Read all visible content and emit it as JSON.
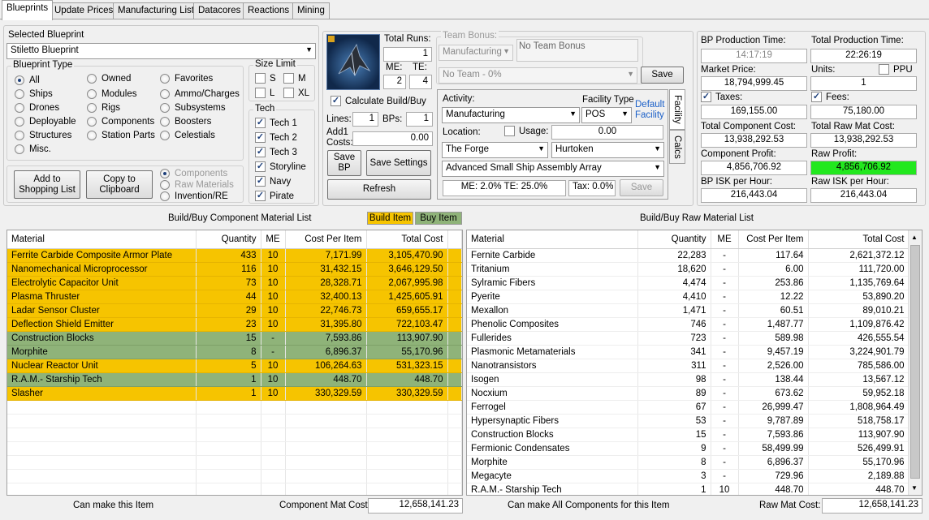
{
  "tabs": [
    "Blueprints",
    "Update Prices",
    "Manufacturing List",
    "Datacores",
    "Reactions",
    "Mining"
  ],
  "selected_blueprint_label": "Selected Blueprint",
  "selected_blueprint": "Stiletto Blueprint",
  "blueprint_type": {
    "title": "Blueprint Type",
    "options": [
      "All",
      "Ships",
      "Drones",
      "Deployable",
      "Structures",
      "Misc.",
      "Owned",
      "Modules",
      "Rigs",
      "Components",
      "Station Parts",
      "Favorites",
      "Ammo/Charges",
      "Subsystems",
      "Boosters",
      "Celestials"
    ]
  },
  "size_limit": {
    "title": "Size Limit",
    "options": [
      "S",
      "M",
      "L",
      "XL"
    ]
  },
  "tech": {
    "title": "Tech",
    "options": [
      "Tech 1",
      "Tech 2",
      "Tech 3",
      "Storyline",
      "Navy",
      "Pirate"
    ]
  },
  "buttons": {
    "add_to_shopping_list": "Add to Shopping List",
    "copy_to_clipboard": "Copy to Clipboard",
    "save_bp": "Save BP",
    "save_settings": "Save Settings",
    "refresh": "Refresh",
    "save": "Save"
  },
  "copy_options": [
    "Components",
    "Raw Materials",
    "Invention/RE"
  ],
  "bp": {
    "total_runs_label": "Total Runs:",
    "total_runs": "1",
    "me_label": "ME:",
    "me": "2",
    "te_label": "TE:",
    "te": "4",
    "calc_build_buy": "Calculate Build/Buy",
    "lines_label": "Lines:",
    "lines": "1",
    "bps_label": "BPs:",
    "bps": "1",
    "add1_costs_label": "Add1 Costs:",
    "add1_costs": "0.00"
  },
  "team": {
    "label": "Team Bonus:",
    "activity": "Manufacturing",
    "bonus_text": "No Team Bonus",
    "team_select": "No Team - 0%"
  },
  "facility": {
    "activity_label": "Activity:",
    "activity": "Manufacturing",
    "facility_type_label": "Facility Type",
    "facility_type": "POS",
    "default_facility": "Default Facility",
    "location_label": "Location:",
    "usage_label": "Usage:",
    "usage": "0.00",
    "region": "The Forge",
    "system": "Hurtoken",
    "array": "Advanced Small Ship Assembly Array",
    "me_te": "ME: 2.0% TE: 25.0%",
    "tax": "Tax: 0.0%",
    "side_tabs": [
      "Facility",
      "Calcs"
    ]
  },
  "stats": {
    "bp_production_time_label": "BP Production Time:",
    "bp_production_time": "14:17:19",
    "total_production_time_label": "Total Production Time:",
    "total_production_time": "22:26:19",
    "market_price_label": "Market Price:",
    "market_price": "18,794,999.45",
    "units_label": "Units:",
    "units": "1",
    "ppu_label": "PPU",
    "taxes_label": "Taxes:",
    "taxes": "169,155.00",
    "fees_label": "Fees:",
    "fees": "75,180.00",
    "total_component_cost_label": "Total Component Cost:",
    "total_component_cost": "13,938,292.53",
    "total_raw_mat_cost_label": "Total Raw Mat Cost:",
    "total_raw_mat_cost": "13,938,292.53",
    "component_profit_label": "Component Profit:",
    "component_profit": "4,856,706.92",
    "raw_profit_label": "Raw Profit:",
    "raw_profit": "4,856,706.92",
    "bp_isk_per_hour_label": "BP ISK per Hour:",
    "bp_isk_per_hour": "216,443.04",
    "raw_isk_per_hour_label": "Raw ISK per Hour:",
    "raw_isk_per_hour": "216,443.04"
  },
  "component_list": {
    "title": "Build/Buy Component Material List",
    "legend_build": "Build Item",
    "legend_buy": "Buy Item",
    "columns": [
      "Material",
      "Quantity",
      "ME",
      "Cost Per Item",
      "Total Cost"
    ],
    "rows": [
      {
        "type": "build",
        "cells": [
          "Ferrite Carbide Composite Armor Plate",
          "433",
          "10",
          "7,171.99",
          "3,105,470.90"
        ]
      },
      {
        "type": "build",
        "cells": [
          "Nanomechanical Microprocessor",
          "116",
          "10",
          "31,432.15",
          "3,646,129.50"
        ]
      },
      {
        "type": "build",
        "cells": [
          "Electrolytic Capacitor Unit",
          "73",
          "10",
          "28,328.71",
          "2,067,995.98"
        ]
      },
      {
        "type": "build",
        "cells": [
          "Plasma Thruster",
          "44",
          "10",
          "32,400.13",
          "1,425,605.91"
        ]
      },
      {
        "type": "build",
        "cells": [
          "Ladar Sensor Cluster",
          "29",
          "10",
          "22,746.73",
          "659,655.17"
        ]
      },
      {
        "type": "build",
        "cells": [
          "Deflection Shield Emitter",
          "23",
          "10",
          "31,395.80",
          "722,103.47"
        ]
      },
      {
        "type": "buy",
        "cells": [
          "Construction Blocks",
          "15",
          "-",
          "7,593.86",
          "113,907.90"
        ]
      },
      {
        "type": "buy",
        "cells": [
          "Morphite",
          "8",
          "-",
          "6,896.37",
          "55,170.96"
        ]
      },
      {
        "type": "build",
        "cells": [
          "Nuclear Reactor Unit",
          "5",
          "10",
          "106,264.63",
          "531,323.15"
        ]
      },
      {
        "type": "buy",
        "cells": [
          "R.A.M.- Starship Tech",
          "1",
          "10",
          "448.70",
          "448.70"
        ]
      },
      {
        "type": "build",
        "cells": [
          "Slasher",
          "1",
          "10",
          "330,329.59",
          "330,329.59"
        ]
      }
    ]
  },
  "raw_list": {
    "title": "Build/Buy Raw Material List",
    "columns": [
      "Material",
      "Quantity",
      "ME",
      "Cost Per Item",
      "Total Cost"
    ],
    "rows": [
      [
        "Fernite Carbide",
        "22,283",
        "-",
        "117.64",
        "2,621,372.12"
      ],
      [
        "Tritanium",
        "18,620",
        "-",
        "6.00",
        "111,720.00"
      ],
      [
        "Sylramic Fibers",
        "4,474",
        "-",
        "253.86",
        "1,135,769.64"
      ],
      [
        "Pyerite",
        "4,410",
        "-",
        "12.22",
        "53,890.20"
      ],
      [
        "Mexallon",
        "1,471",
        "-",
        "60.51",
        "89,010.21"
      ],
      [
        "Phenolic Composites",
        "746",
        "-",
        "1,487.77",
        "1,109,876.42"
      ],
      [
        "Fullerides",
        "723",
        "-",
        "589.98",
        "426,555.54"
      ],
      [
        "Plasmonic Metamaterials",
        "341",
        "-",
        "9,457.19",
        "3,224,901.79"
      ],
      [
        "Nanotransistors",
        "311",
        "-",
        "2,526.00",
        "785,586.00"
      ],
      [
        "Isogen",
        "98",
        "-",
        "138.44",
        "13,567.12"
      ],
      [
        "Nocxium",
        "89",
        "-",
        "673.62",
        "59,952.18"
      ],
      [
        "Ferrogel",
        "67",
        "-",
        "26,999.47",
        "1,808,964.49"
      ],
      [
        "Hypersynaptic Fibers",
        "53",
        "-",
        "9,787.89",
        "518,758.17"
      ],
      [
        "Construction Blocks",
        "15",
        "-",
        "7,593.86",
        "113,907.90"
      ],
      [
        "Fermionic Condensates",
        "9",
        "-",
        "58,499.99",
        "526,499.91"
      ],
      [
        "Morphite",
        "8",
        "-",
        "6,896.37",
        "55,170.96"
      ],
      [
        "Megacyte",
        "3",
        "-",
        "729.96",
        "2,189.88"
      ],
      [
        "R.A.M.- Starship Tech",
        "1",
        "10",
        "448.70",
        "448.70"
      ]
    ]
  },
  "footer": {
    "can_make_item": "Can make this Item",
    "component_mat_cost_label": "Component Mat Cost:",
    "component_mat_cost": "12,658,141.23",
    "can_make_all_components": "Can make All Components for this Item",
    "raw_mat_cost_label": "Raw Mat Cost:",
    "raw_mat_cost": "12,658,141.23"
  },
  "colors": {
    "build": "#f6c400",
    "buy": "#8fb379",
    "raw_profit_bg": "#22e81e"
  }
}
